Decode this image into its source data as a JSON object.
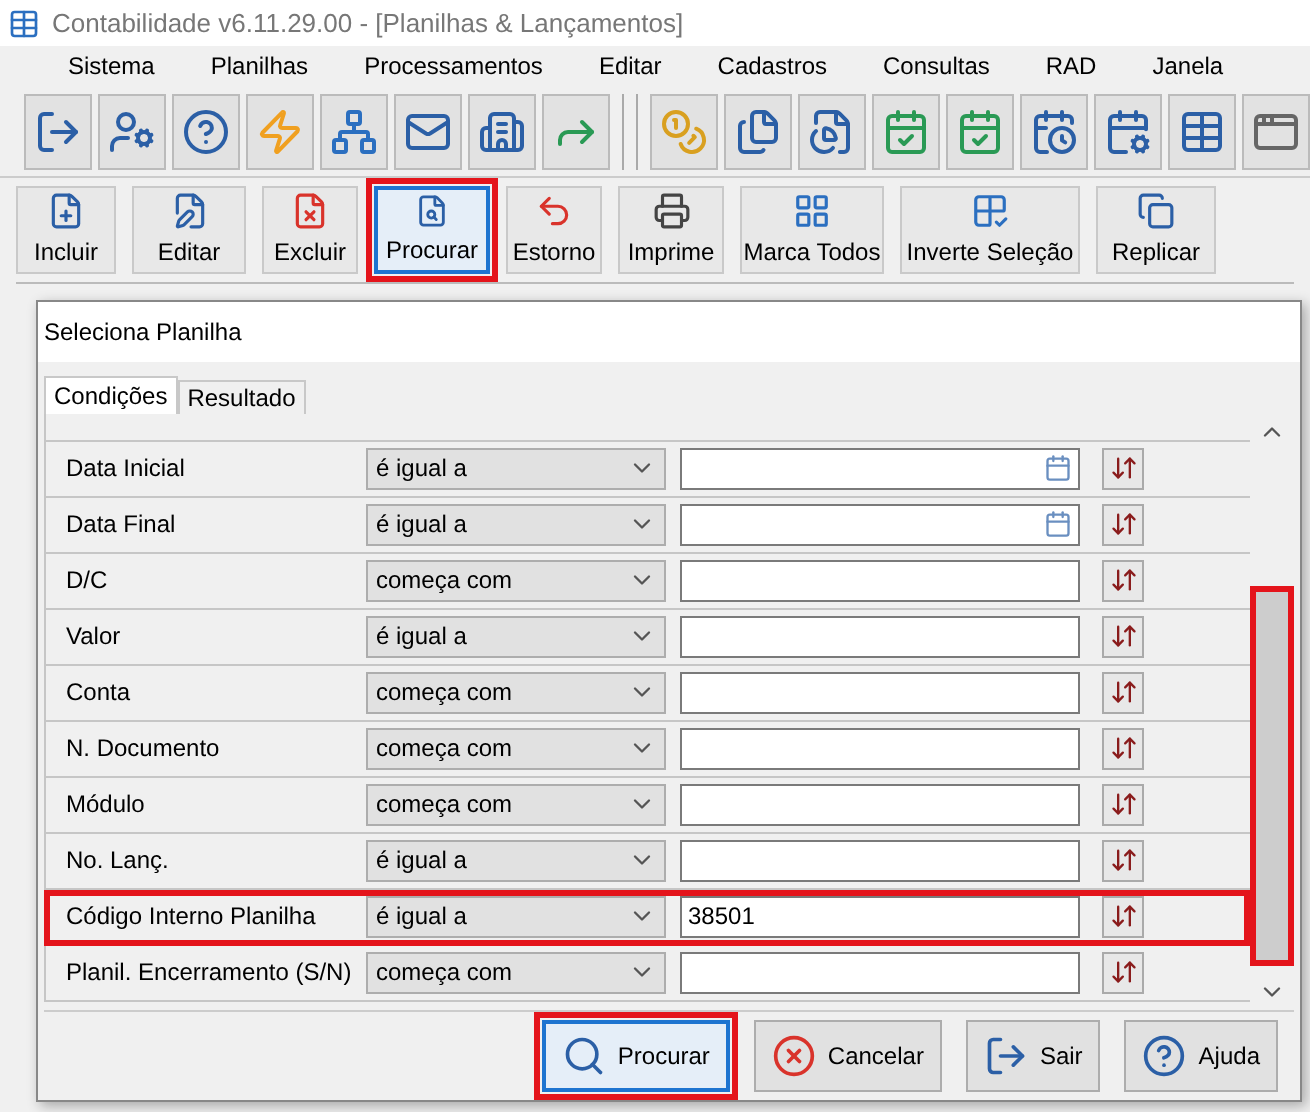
{
  "window": {
    "title": "Contabilidade v6.11.29.00 - [Planilhas & Lançamentos]"
  },
  "menu": [
    "Sistema",
    "Planilhas",
    "Processamentos",
    "Editar",
    "Cadastros",
    "Consultas",
    "RAD",
    "Janela"
  ],
  "actions": [
    {
      "label": "Incluir",
      "kind": "new",
      "selected": false,
      "highlighted": false
    },
    {
      "label": "Editar",
      "kind": "edit",
      "selected": false,
      "highlighted": false
    },
    {
      "label": "Excluir",
      "kind": "delete",
      "selected": false,
      "highlighted": false
    },
    {
      "label": "Procurar",
      "kind": "search",
      "selected": true,
      "highlighted": true
    },
    {
      "label": "Estorno",
      "kind": "reverse",
      "selected": false,
      "highlighted": false
    },
    {
      "label": "Imprime",
      "kind": "print",
      "selected": false,
      "highlighted": false
    },
    {
      "label": "Marca Todos",
      "kind": "grid",
      "selected": false,
      "highlighted": false
    },
    {
      "label": "Inverte Seleção",
      "kind": "invert",
      "selected": false,
      "highlighted": false
    },
    {
      "label": "Replicar",
      "kind": "replicate",
      "selected": false,
      "highlighted": false
    }
  ],
  "dialog": {
    "title": "Seleciona Planilha",
    "tabs": [
      {
        "label": "Condições",
        "selected": true
      },
      {
        "label": "Resultado",
        "selected": false
      }
    ],
    "rows": [
      {
        "label": "Data Inicial",
        "condition": "é igual a",
        "value": "",
        "kind": "date",
        "highlighted": false
      },
      {
        "label": "Data Final",
        "condition": "é igual a",
        "value": "",
        "kind": "date",
        "highlighted": false
      },
      {
        "label": "D/C",
        "condition": "começa com",
        "value": "",
        "kind": "text",
        "highlighted": false
      },
      {
        "label": "Valor",
        "condition": "é igual a",
        "value": "",
        "kind": "text",
        "highlighted": false
      },
      {
        "label": "Conta",
        "condition": "começa com",
        "value": "",
        "kind": "text",
        "highlighted": false
      },
      {
        "label": "N. Documento",
        "condition": "começa com",
        "value": "",
        "kind": "text",
        "highlighted": false
      },
      {
        "label": "Módulo",
        "condition": "começa com",
        "value": "",
        "kind": "text",
        "highlighted": false
      },
      {
        "label": "No. Lanç.",
        "condition": "é igual a",
        "value": "",
        "kind": "text",
        "highlighted": false
      },
      {
        "label": "Código Interno Planilha",
        "condition": "é igual a",
        "value": "38501",
        "kind": "text",
        "highlighted": true
      },
      {
        "label": "Planil. Encerramento (S/N)",
        "condition": "começa com",
        "value": "",
        "kind": "text",
        "highlighted": false
      }
    ],
    "scrollbar_highlighted": true,
    "buttons": [
      {
        "label": "Procurar",
        "kind": "search",
        "selected": true,
        "highlighted": true
      },
      {
        "label": "Cancelar",
        "kind": "cancel",
        "selected": false,
        "highlighted": false
      },
      {
        "label": "Sair",
        "kind": "exit",
        "selected": false,
        "highlighted": false
      },
      {
        "label": "Ajuda",
        "kind": "help",
        "selected": false,
        "highlighted": false
      }
    ]
  }
}
